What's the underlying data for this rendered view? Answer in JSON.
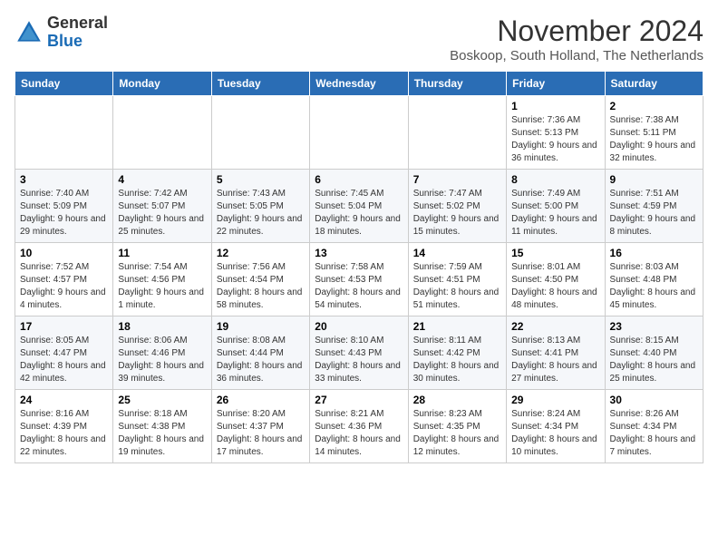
{
  "header": {
    "logo_general": "General",
    "logo_blue": "Blue",
    "month_title": "November 2024",
    "subtitle": "Boskoop, South Holland, The Netherlands"
  },
  "weekdays": [
    "Sunday",
    "Monday",
    "Tuesday",
    "Wednesday",
    "Thursday",
    "Friday",
    "Saturday"
  ],
  "weeks": [
    [
      {
        "day": "",
        "sunrise": "",
        "sunset": "",
        "daylight": ""
      },
      {
        "day": "",
        "sunrise": "",
        "sunset": "",
        "daylight": ""
      },
      {
        "day": "",
        "sunrise": "",
        "sunset": "",
        "daylight": ""
      },
      {
        "day": "",
        "sunrise": "",
        "sunset": "",
        "daylight": ""
      },
      {
        "day": "",
        "sunrise": "",
        "sunset": "",
        "daylight": ""
      },
      {
        "day": "1",
        "sunrise": "Sunrise: 7:36 AM",
        "sunset": "Sunset: 5:13 PM",
        "daylight": "Daylight: 9 hours and 36 minutes."
      },
      {
        "day": "2",
        "sunrise": "Sunrise: 7:38 AM",
        "sunset": "Sunset: 5:11 PM",
        "daylight": "Daylight: 9 hours and 32 minutes."
      }
    ],
    [
      {
        "day": "3",
        "sunrise": "Sunrise: 7:40 AM",
        "sunset": "Sunset: 5:09 PM",
        "daylight": "Daylight: 9 hours and 29 minutes."
      },
      {
        "day": "4",
        "sunrise": "Sunrise: 7:42 AM",
        "sunset": "Sunset: 5:07 PM",
        "daylight": "Daylight: 9 hours and 25 minutes."
      },
      {
        "day": "5",
        "sunrise": "Sunrise: 7:43 AM",
        "sunset": "Sunset: 5:05 PM",
        "daylight": "Daylight: 9 hours and 22 minutes."
      },
      {
        "day": "6",
        "sunrise": "Sunrise: 7:45 AM",
        "sunset": "Sunset: 5:04 PM",
        "daylight": "Daylight: 9 hours and 18 minutes."
      },
      {
        "day": "7",
        "sunrise": "Sunrise: 7:47 AM",
        "sunset": "Sunset: 5:02 PM",
        "daylight": "Daylight: 9 hours and 15 minutes."
      },
      {
        "day": "8",
        "sunrise": "Sunrise: 7:49 AM",
        "sunset": "Sunset: 5:00 PM",
        "daylight": "Daylight: 9 hours and 11 minutes."
      },
      {
        "day": "9",
        "sunrise": "Sunrise: 7:51 AM",
        "sunset": "Sunset: 4:59 PM",
        "daylight": "Daylight: 9 hours and 8 minutes."
      }
    ],
    [
      {
        "day": "10",
        "sunrise": "Sunrise: 7:52 AM",
        "sunset": "Sunset: 4:57 PM",
        "daylight": "Daylight: 9 hours and 4 minutes."
      },
      {
        "day": "11",
        "sunrise": "Sunrise: 7:54 AM",
        "sunset": "Sunset: 4:56 PM",
        "daylight": "Daylight: 9 hours and 1 minute."
      },
      {
        "day": "12",
        "sunrise": "Sunrise: 7:56 AM",
        "sunset": "Sunset: 4:54 PM",
        "daylight": "Daylight: 8 hours and 58 minutes."
      },
      {
        "day": "13",
        "sunrise": "Sunrise: 7:58 AM",
        "sunset": "Sunset: 4:53 PM",
        "daylight": "Daylight: 8 hours and 54 minutes."
      },
      {
        "day": "14",
        "sunrise": "Sunrise: 7:59 AM",
        "sunset": "Sunset: 4:51 PM",
        "daylight": "Daylight: 8 hours and 51 minutes."
      },
      {
        "day": "15",
        "sunrise": "Sunrise: 8:01 AM",
        "sunset": "Sunset: 4:50 PM",
        "daylight": "Daylight: 8 hours and 48 minutes."
      },
      {
        "day": "16",
        "sunrise": "Sunrise: 8:03 AM",
        "sunset": "Sunset: 4:48 PM",
        "daylight": "Daylight: 8 hours and 45 minutes."
      }
    ],
    [
      {
        "day": "17",
        "sunrise": "Sunrise: 8:05 AM",
        "sunset": "Sunset: 4:47 PM",
        "daylight": "Daylight: 8 hours and 42 minutes."
      },
      {
        "day": "18",
        "sunrise": "Sunrise: 8:06 AM",
        "sunset": "Sunset: 4:46 PM",
        "daylight": "Daylight: 8 hours and 39 minutes."
      },
      {
        "day": "19",
        "sunrise": "Sunrise: 8:08 AM",
        "sunset": "Sunset: 4:44 PM",
        "daylight": "Daylight: 8 hours and 36 minutes."
      },
      {
        "day": "20",
        "sunrise": "Sunrise: 8:10 AM",
        "sunset": "Sunset: 4:43 PM",
        "daylight": "Daylight: 8 hours and 33 minutes."
      },
      {
        "day": "21",
        "sunrise": "Sunrise: 8:11 AM",
        "sunset": "Sunset: 4:42 PM",
        "daylight": "Daylight: 8 hours and 30 minutes."
      },
      {
        "day": "22",
        "sunrise": "Sunrise: 8:13 AM",
        "sunset": "Sunset: 4:41 PM",
        "daylight": "Daylight: 8 hours and 27 minutes."
      },
      {
        "day": "23",
        "sunrise": "Sunrise: 8:15 AM",
        "sunset": "Sunset: 4:40 PM",
        "daylight": "Daylight: 8 hours and 25 minutes."
      }
    ],
    [
      {
        "day": "24",
        "sunrise": "Sunrise: 8:16 AM",
        "sunset": "Sunset: 4:39 PM",
        "daylight": "Daylight: 8 hours and 22 minutes."
      },
      {
        "day": "25",
        "sunrise": "Sunrise: 8:18 AM",
        "sunset": "Sunset: 4:38 PM",
        "daylight": "Daylight: 8 hours and 19 minutes."
      },
      {
        "day": "26",
        "sunrise": "Sunrise: 8:20 AM",
        "sunset": "Sunset: 4:37 PM",
        "daylight": "Daylight: 8 hours and 17 minutes."
      },
      {
        "day": "27",
        "sunrise": "Sunrise: 8:21 AM",
        "sunset": "Sunset: 4:36 PM",
        "daylight": "Daylight: 8 hours and 14 minutes."
      },
      {
        "day": "28",
        "sunrise": "Sunrise: 8:23 AM",
        "sunset": "Sunset: 4:35 PM",
        "daylight": "Daylight: 8 hours and 12 minutes."
      },
      {
        "day": "29",
        "sunrise": "Sunrise: 8:24 AM",
        "sunset": "Sunset: 4:34 PM",
        "daylight": "Daylight: 8 hours and 10 minutes."
      },
      {
        "day": "30",
        "sunrise": "Sunrise: 8:26 AM",
        "sunset": "Sunset: 4:34 PM",
        "daylight": "Daylight: 8 hours and 7 minutes."
      }
    ]
  ]
}
